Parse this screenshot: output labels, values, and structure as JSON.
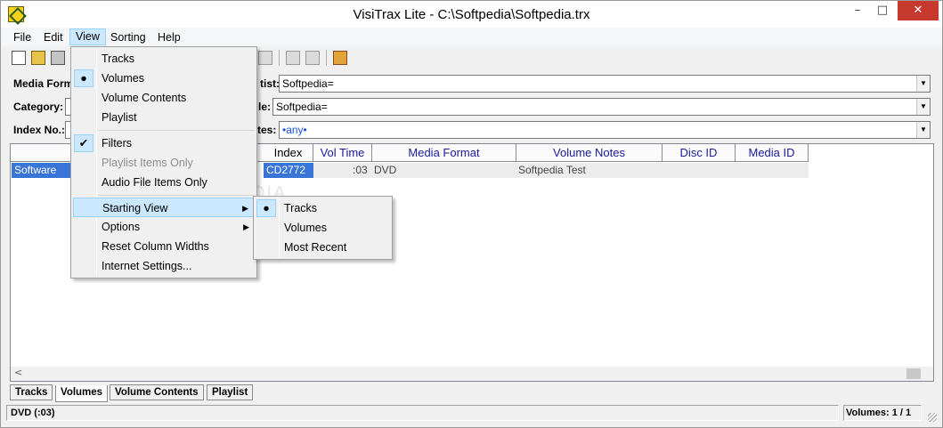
{
  "window": {
    "title": "VisiTrax Lite - C:\\Softpedia\\Softpedia.trx",
    "minimize": "–",
    "maximize": "□",
    "close": "✕"
  },
  "menubar": [
    "File",
    "Edit",
    "View",
    "Sorting",
    "Help"
  ],
  "filters": {
    "media_format_label": "Media Form",
    "category_label": "Category:",
    "index_label": "Index No.:",
    "artist_label": "tist:",
    "artist_value": "Softpedia=",
    "title_label": "le:",
    "title_value": "Softpedia=",
    "notes_label": "tes:",
    "notes_value": "•any•"
  },
  "list": {
    "columns": [
      "Index",
      "Vol Time",
      "Media Format",
      "Volume Notes",
      "Disc ID",
      "Media ID"
    ],
    "rows": [
      {
        "first": "Software",
        "index": "CD2772",
        "vol_time": ":03",
        "media_format": "DVD",
        "volume_notes": "Softpedia Test",
        "disc_id": "",
        "media_id": ""
      }
    ],
    "scroll_left": "<"
  },
  "tabs": [
    "Tracks",
    "Volumes",
    "Volume Contents",
    "Playlist"
  ],
  "active_tab": "Volumes",
  "status": {
    "left": "DVD (:03)",
    "right": "Volumes: 1 / 1"
  },
  "view_menu": {
    "items": [
      {
        "label": "Tracks"
      },
      {
        "label": "Volumes",
        "glyph": "●"
      },
      {
        "label": "Volume Contents"
      },
      {
        "label": "Playlist"
      },
      {
        "label": "Filters",
        "glyph": "✔"
      },
      {
        "label": "Playlist Items Only"
      },
      {
        "label": "Audio File Items Only"
      },
      {
        "label": "Starting View"
      },
      {
        "label": "Options"
      },
      {
        "label": "Reset Column Widths"
      },
      {
        "label": "Internet Settings..."
      }
    ]
  },
  "starting_view_menu": {
    "items": [
      {
        "label": "Tracks",
        "glyph": "●"
      },
      {
        "label": "Volumes"
      },
      {
        "label": "Most Recent"
      }
    ]
  },
  "watermark": "SOFTPEDIA"
}
